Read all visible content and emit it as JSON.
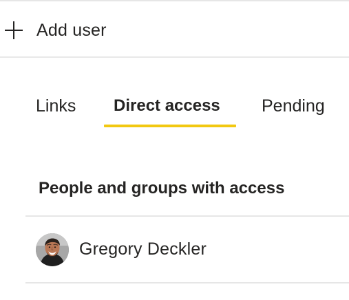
{
  "add_user": {
    "label": "Add user",
    "icon": "plus-icon"
  },
  "tabs": [
    {
      "label": "Links",
      "selected": false
    },
    {
      "label": "Direct access",
      "selected": true
    },
    {
      "label": "Pending",
      "selected": false
    }
  ],
  "colors": {
    "tab_indicator": "#f2c811",
    "text": "#252423",
    "divider": "#e6e6e6"
  },
  "access": {
    "heading": "People and groups with access",
    "people": [
      {
        "name": "Gregory Deckler",
        "avatar": "user-photo"
      }
    ]
  }
}
